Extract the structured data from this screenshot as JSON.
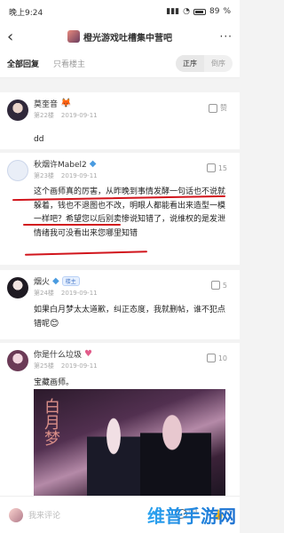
{
  "status": {
    "time": "晚上9:24",
    "battery": "89"
  },
  "header": {
    "title": "橙光游戏吐槽集中营吧",
    "more": "···"
  },
  "filter": {
    "tabs": [
      "全部回复",
      "只看楼主"
    ],
    "sort": [
      "正序",
      "倒序"
    ]
  },
  "posts": [
    {
      "name": "莫奎音",
      "floor": "第22楼",
      "date": "2019-09-11",
      "likes": "赞",
      "text": "dd"
    },
    {
      "name": "秋烟许Mabel2",
      "floor": "第23楼",
      "date": "2019-09-11",
      "likes": "15",
      "text": "这个画师真的厉害，从昨晚到事情发酵一句话也不说就躲着，钱也不退图也不改，明眼人都能看出来造型一模一样吧？希望您以后别卖惨说知错了，说维权的是发泄情绪我可没看出来您哪里知错"
    },
    {
      "name": "烟火",
      "badge": "楼主",
      "floor": "第24楼",
      "date": "2019-09-11",
      "likes": "5",
      "text": "如果白月梦太太道歉，纠正态度，我就删帖，谁不犯点错呢"
    },
    {
      "name": "你是什么垃圾",
      "floor": "第25楼",
      "date": "2019-09-11",
      "likes": "10",
      "text": "宝藏画师。"
    }
  ],
  "image": {
    "caption": "白月梦"
  },
  "bottom": {
    "placeholder": "我来评论",
    "reply_count": "134",
    "like_count": "37"
  },
  "watermark": "维普手游网",
  "colors": {
    "annotation": "#d1151c",
    "accent": "#4a7ac8"
  }
}
